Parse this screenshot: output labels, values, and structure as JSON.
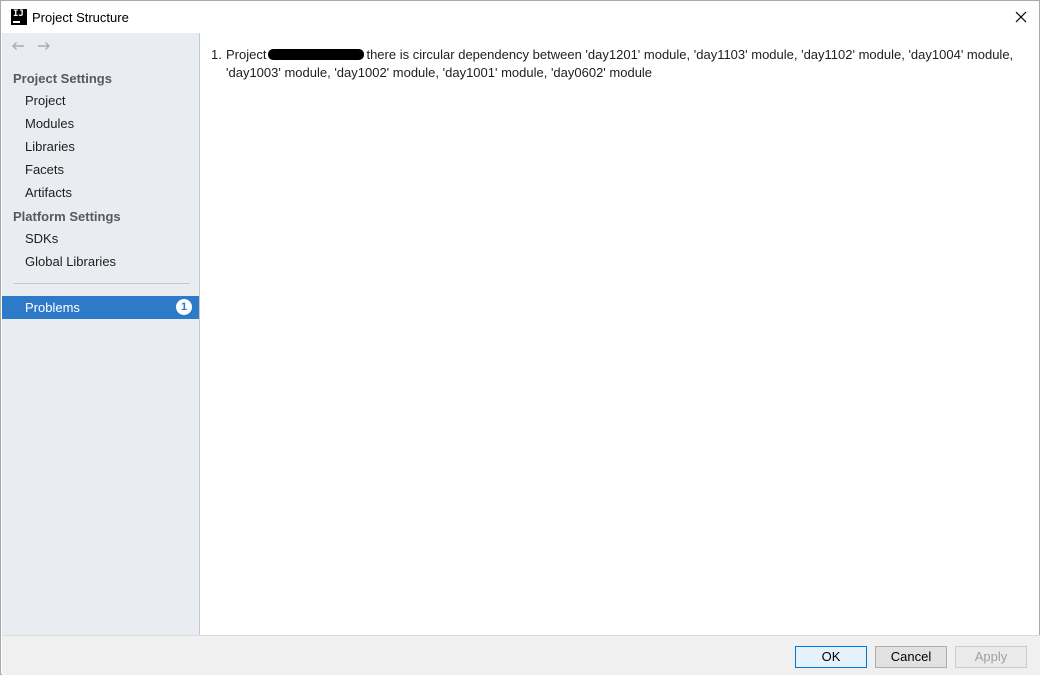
{
  "window": {
    "title": "Project Structure"
  },
  "sidebar": {
    "sections": [
      {
        "header": "Project Settings",
        "items": [
          "Project",
          "Modules",
          "Libraries",
          "Facets",
          "Artifacts"
        ]
      },
      {
        "header": "Platform Settings",
        "items": [
          "SDKs",
          "Global Libraries"
        ]
      }
    ],
    "problems": {
      "label": "Problems",
      "count": "1"
    }
  },
  "content": {
    "problems": [
      {
        "number": "1.",
        "prefix": "Project",
        "message": "there is circular dependency between 'day1201' module, 'day1103' module, 'day1102' module, 'day1004' module, 'day1003' module, 'day1002' module, 'day1001' module, 'day0602' module"
      }
    ]
  },
  "footer": {
    "ok_label": "OK",
    "cancel_label": "Cancel",
    "apply_label": "Apply"
  },
  "colors": {
    "selection": "#2d7ac9",
    "sidebar_bg": "#e9edf1"
  }
}
